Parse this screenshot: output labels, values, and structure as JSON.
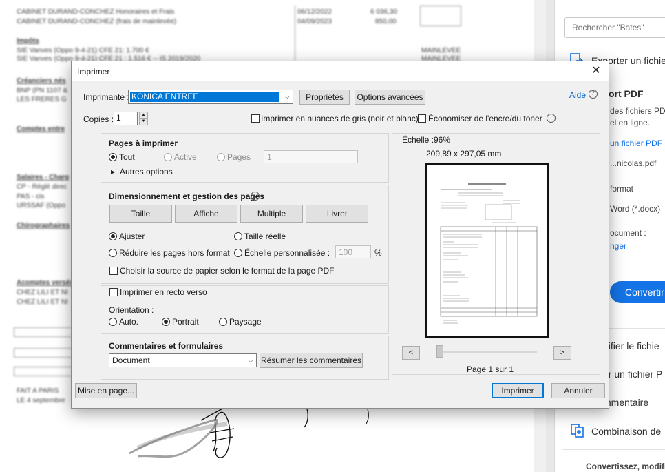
{
  "dialog": {
    "title": "Imprimer",
    "help_label": "Aide",
    "printer": {
      "label": "Imprimante :",
      "value": "KONICA ENTREE",
      "properties_button": "Propriétés",
      "advanced_button": "Options avancées"
    },
    "copies": {
      "label": "Copies :",
      "value": "1"
    },
    "grayscale_label": "Imprimer en nuances de gris (noir et blanc)",
    "save_ink_label": "Économiser de l'encre/du toner",
    "pages_section": {
      "title": "Pages à imprimer",
      "options": [
        "Tout",
        "Active",
        "Pages"
      ],
      "selected": "Tout",
      "pages_value": "1",
      "more_options": "Autres options"
    },
    "sizing_section": {
      "title": "Dimensionnement et gestion des pages",
      "tabs": [
        "Taille",
        "Affiche",
        "Multiple",
        "Livret"
      ],
      "fit_label": "Ajuster",
      "actual_size_label": "Taille réelle",
      "shrink_label": "Réduire les pages hors format",
      "custom_scale_label": "Échelle personnalisée :",
      "custom_scale_value": "100",
      "percent_symbol": "%",
      "paper_source_label": "Choisir la source de papier selon le format de la page PDF"
    },
    "duplex_label": "Imprimer en recto verso",
    "orientation": {
      "label": "Orientation :",
      "options": [
        "Auto.",
        "Portrait",
        "Paysage"
      ],
      "selected": "Portrait"
    },
    "comments_section": {
      "title": "Commentaires et formulaires",
      "value": "Document",
      "summarize_button": "Résumer les commentaires"
    },
    "preview": {
      "scale_label": "Échelle :",
      "scale_value": "96%",
      "dimensions": "209,89 x 297,05 mm",
      "page_indicator": "Page 1 sur 1",
      "prev_label": "<",
      "next_label": ">"
    },
    "page_setup_button": "Mise en page...",
    "print_button": "Imprimer",
    "cancel_button": "Annuler"
  },
  "tools_panel": {
    "search_placeholder": "Rechercher \"Bates\"",
    "export_label": "Exporter un fichier",
    "export_pdf_title": "ort PDF",
    "export_desc_1": "des fichiers PD",
    "export_desc_2": "el en ligne.",
    "select_file_link": "un fichier PDF",
    "file_name": "...nicolas.pdf",
    "format_label": "format",
    "word_format": "Word (*.docx)",
    "doc_language_label": "ocument :",
    "change_link": "nger",
    "convert_button": "Convertir",
    "edit_label": "difier le fichie",
    "create_label": "er un fichier P",
    "comment_label": "mmentaire",
    "combine_label": "Combinaison de",
    "bottom_text": "Convertissez, modifi"
  },
  "background_doc": {
    "lines": [
      "CABINET DURAND-CONCHEZ Honoraires et Frais",
      "CABINET DURAND-CONCHEZ (frais de mainlevée)",
      "Impôts",
      "SIE Vanves (Oppo 9-4-21) CFE 21: 1.700 €",
      "SIE Vanves (Oppo 9-4-21) CFE 21 : 1.516 € -- IS 2019/2020",
      "Créanciers nés",
      "BNP (PN 1107 &",
      "LES FRERES G",
      "Comptes entre",
      "Salaires - Charg",
      "CP - Réglé direc",
      "PAS - cis",
      "URSSAF (Oppo",
      "Chirographaires",
      "Acomptes versés",
      "CHEZ LILI ET NI",
      "CHEZ LILI ET NI",
      "FAIT A PARIS",
      "LE 4 septembre"
    ],
    "dates": [
      "06/12/2022",
      "04/09/2023"
    ],
    "amounts": [
      "6 036,30",
      "850,00"
    ],
    "mainlevee": [
      "MAINLEVEE",
      "MAINLEVEE"
    ]
  }
}
